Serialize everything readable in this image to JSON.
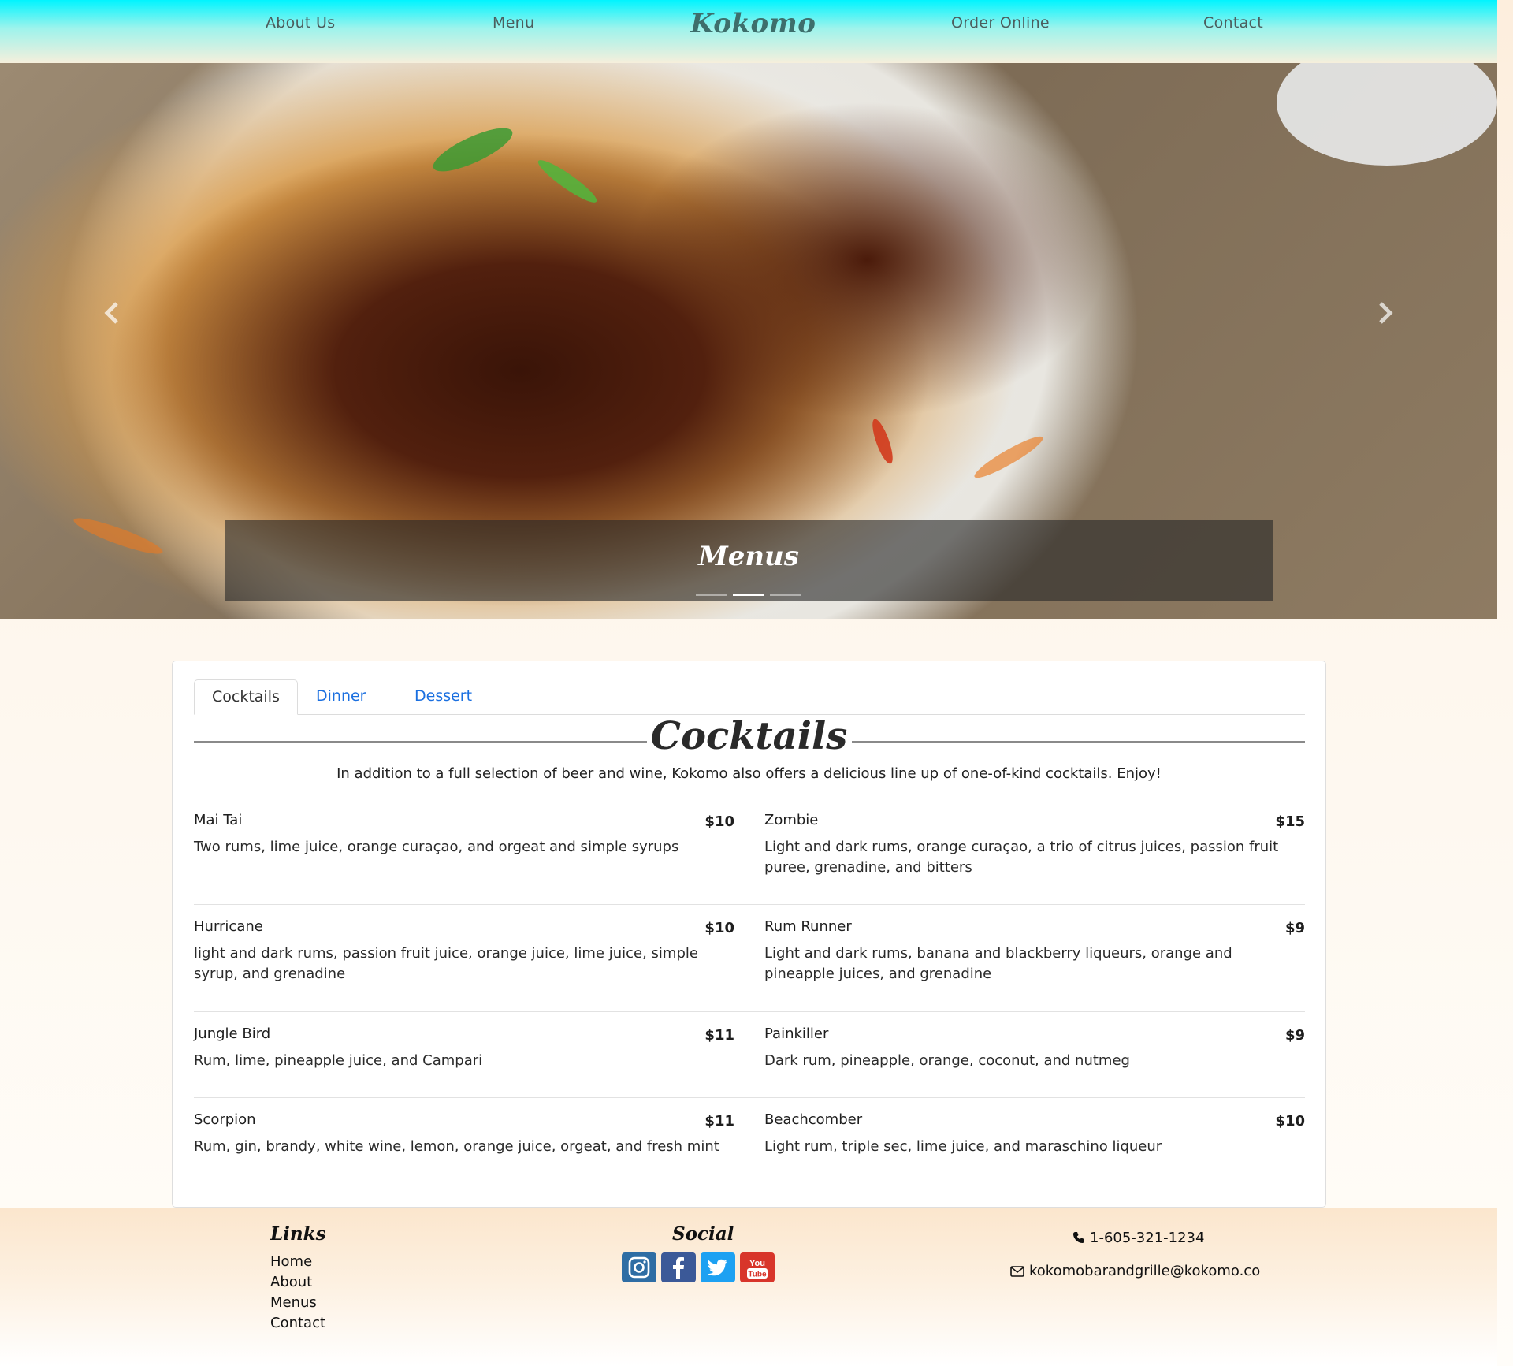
{
  "nav": {
    "about": "About Us",
    "menu": "Menu",
    "brand": "Kokomo",
    "order": "Order Online",
    "contact": "Contact"
  },
  "hero": {
    "caption": "Menus",
    "prev_icon": "chevron-left-icon",
    "next_icon": "chevron-right-icon",
    "slide_count": 3,
    "active_slide": 2
  },
  "menu": {
    "tabs": [
      {
        "label": "Cocktails",
        "active": true
      },
      {
        "label": "Dinner",
        "active": false
      },
      {
        "label": "Dessert",
        "active": false
      }
    ],
    "title": "Cocktails",
    "intro": "In addition to a full selection of beer and wine, Kokomo also offers a delicious line up of one-of-kind cocktails. Enjoy!",
    "items": [
      {
        "name": "Mai Tai",
        "price": "$10",
        "desc": "Two rums, lime juice, orange curaçao, and orgeat and simple syrups"
      },
      {
        "name": "Zombie",
        "price": "$15",
        "desc": "Light and dark rums, orange curaçao, a trio of citrus juices, passion fruit puree, grenadine, and bitters"
      },
      {
        "name": "Hurricane",
        "price": "$10",
        "desc": "light and dark rums, passion fruit juice, orange juice, lime juice, simple syrup, and grenadine"
      },
      {
        "name": "Rum Runner",
        "price": "$9",
        "desc": "Light and dark rums, banana and blackberry liqueurs, orange and pineapple juices, and grenadine"
      },
      {
        "name": "Jungle Bird",
        "price": "$11",
        "desc": "Rum, lime, pineapple juice, and Campari"
      },
      {
        "name": "Painkiller",
        "price": "$9",
        "desc": "Dark rum, pineapple, orange, coconut, and nutmeg"
      },
      {
        "name": "Scorpion",
        "price": "$11",
        "desc": "Rum, gin, brandy, white wine, lemon, orange juice, orgeat, and fresh mint"
      },
      {
        "name": "Beachcomber",
        "price": "$10",
        "desc": "Light rum, triple sec, lime juice, and maraschino liqueur"
      }
    ]
  },
  "footer": {
    "links_heading": "Links",
    "links": [
      "Home",
      "About",
      "Menus",
      "Contact"
    ],
    "social_heading": "Social",
    "social": [
      {
        "name": "instagram-icon",
        "color": "#2e6da4"
      },
      {
        "name": "facebook-icon",
        "color": "#3b5998"
      },
      {
        "name": "twitter-icon",
        "color": "#1da1f2"
      },
      {
        "name": "youtube-icon",
        "color": "#d8352a",
        "label_top": "You",
        "label_bottom": "Tube"
      }
    ],
    "phone": "1-605-321-1234",
    "email": "kokomobarandgrille@kokomo.co"
  },
  "colors": {
    "nav_top": "#00f4ff",
    "brand": "#3d6f6c",
    "tab_link": "#1a6fe0"
  }
}
